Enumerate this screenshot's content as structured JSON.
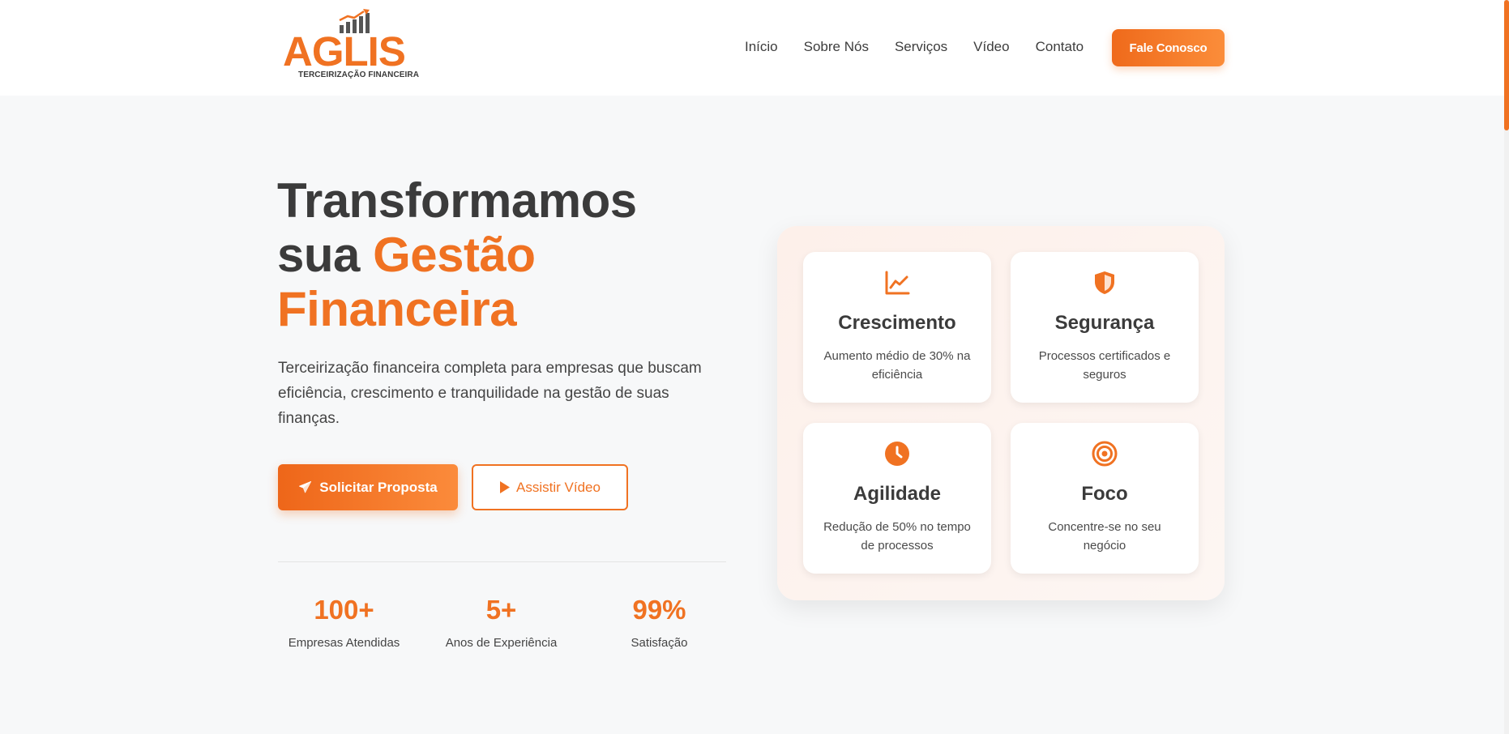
{
  "brand": {
    "name": "AGLIS",
    "tagline": "TERCEIRIZAÇÃO FINANCEIRA",
    "accent_color": "#f07222"
  },
  "nav": {
    "items": [
      {
        "label": "Início"
      },
      {
        "label": "Sobre Nós"
      },
      {
        "label": "Serviços"
      },
      {
        "label": "Vídeo"
      },
      {
        "label": "Contato"
      }
    ],
    "cta_label": "Fale Conosco"
  },
  "hero": {
    "title_line1": "Transformamos",
    "title_line2_plain": "sua",
    "title_accent_1": "Gestão",
    "title_accent_2": "Financeira",
    "description": "Terceirização financeira completa para empresas que buscam eficiência, crescimento e tranquilidade na gestão de suas finanças.",
    "primary_button": {
      "label": "Solicitar Proposta",
      "icon": "paper-plane-icon"
    },
    "secondary_button": {
      "label": "Assistir Vídeo",
      "icon": "play-icon"
    }
  },
  "stats": [
    {
      "value": "100+",
      "label": "Empresas Atendidas"
    },
    {
      "value": "5+",
      "label": "Anos de Experiência"
    },
    {
      "value": "99%",
      "label": "Satisfação"
    }
  ],
  "features": [
    {
      "icon": "chart-line-icon",
      "title": "Crescimento",
      "text": "Aumento médio de 30% na eficiência"
    },
    {
      "icon": "shield-icon",
      "title": "Segurança",
      "text": "Processos certificados e seguros"
    },
    {
      "icon": "clock-icon",
      "title": "Agilidade",
      "text": "Redução de 50% no tempo de processos"
    },
    {
      "icon": "target-icon",
      "title": "Foco",
      "text": "Concentre-se no seu negócio"
    }
  ]
}
